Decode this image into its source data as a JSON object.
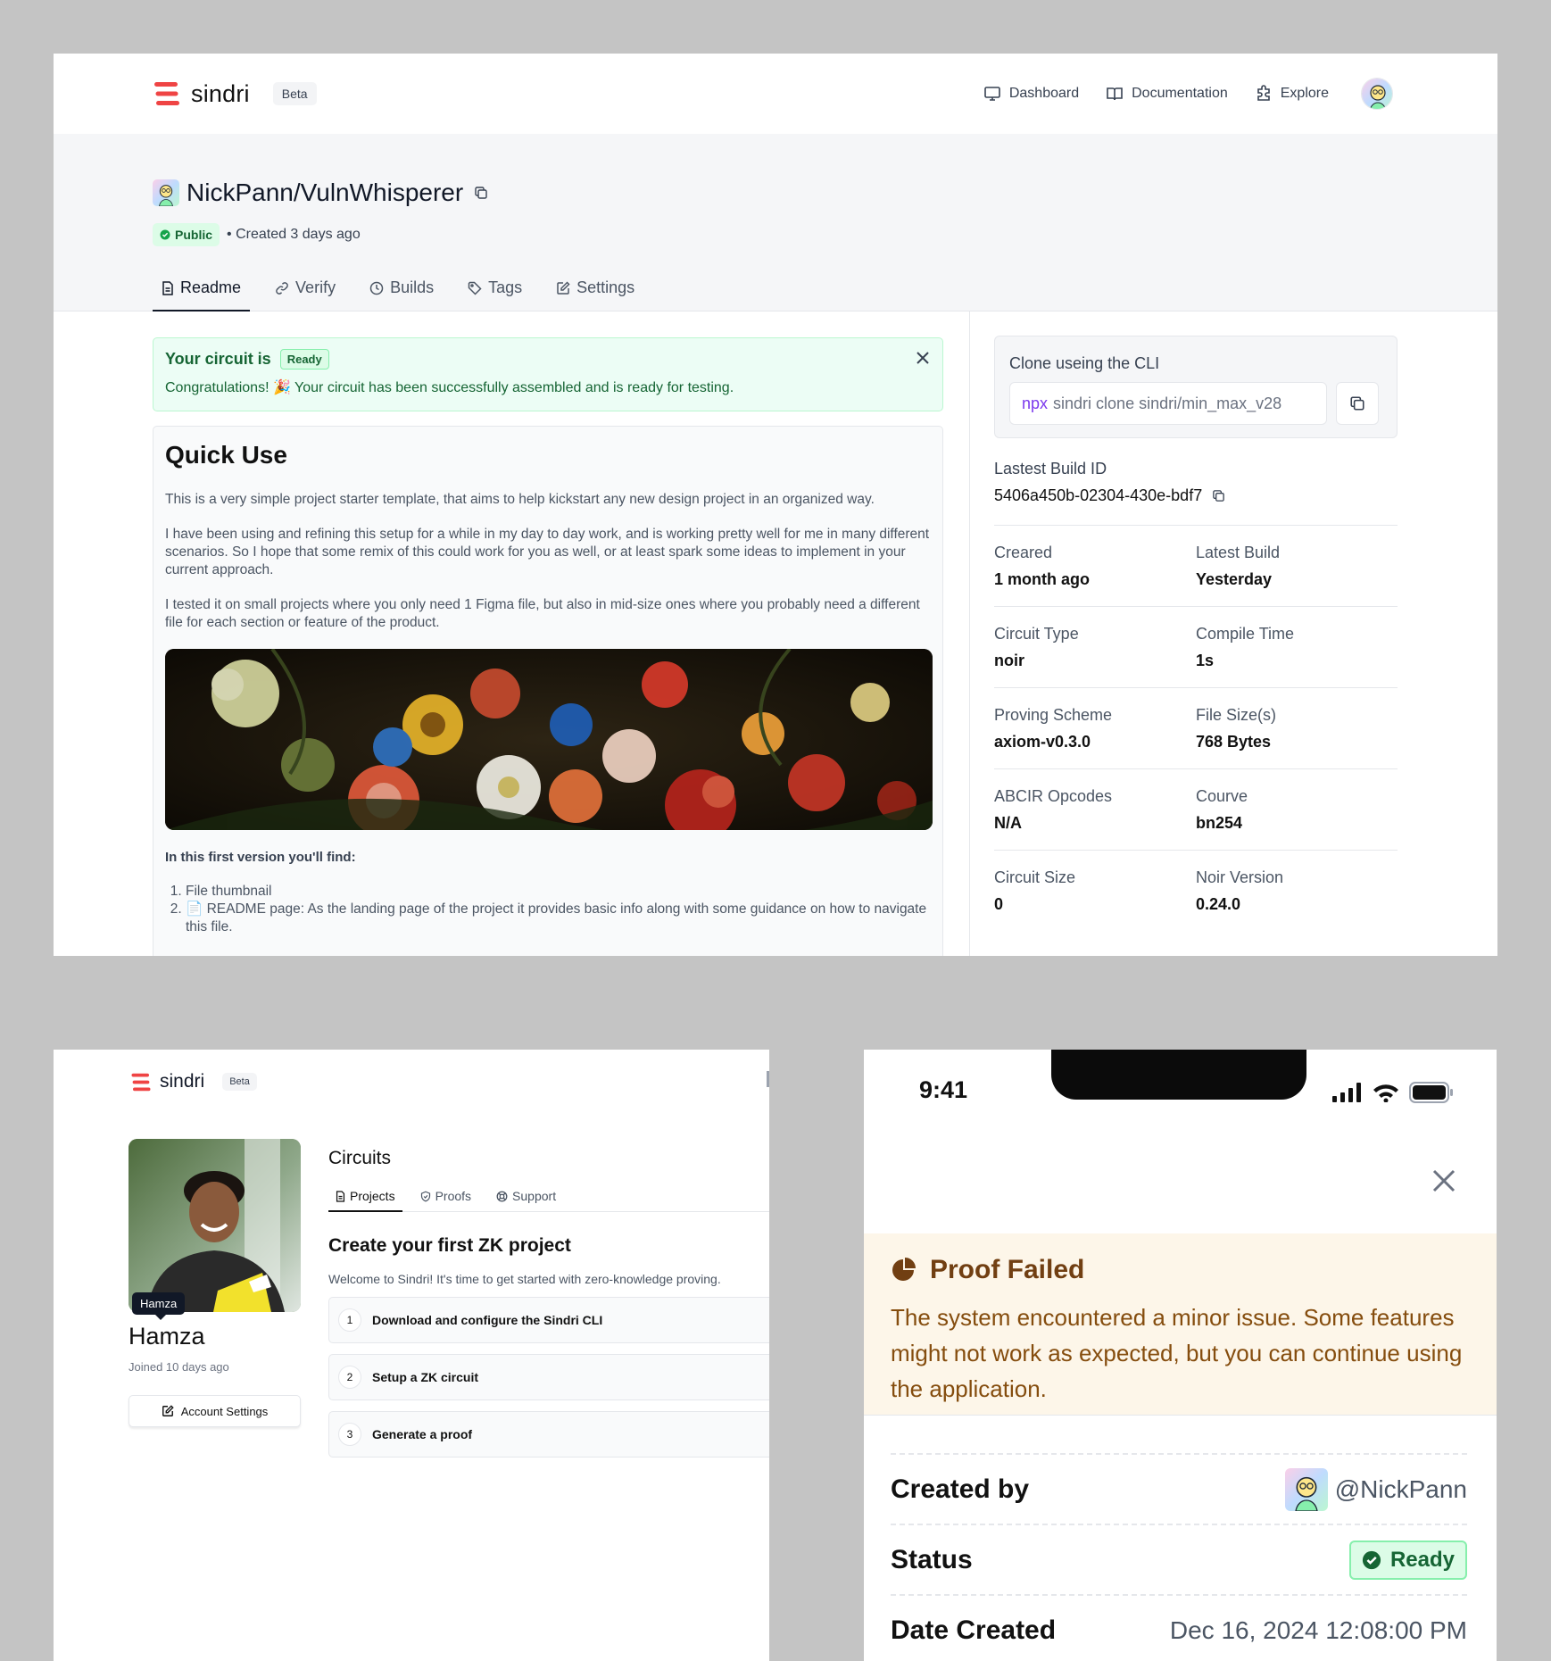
{
  "colors": {
    "brand": "#ef4444",
    "success": "#166534",
    "warning": "#713f12",
    "accent_purple": "#7c3aed"
  },
  "top": {
    "brand": {
      "name": "sindri",
      "beta": "Beta"
    },
    "nav": [
      {
        "label": "Dashboard",
        "icon": "monitor-icon"
      },
      {
        "label": "Documentation",
        "icon": "book-icon"
      },
      {
        "label": "Explore",
        "icon": "puzzle-icon"
      }
    ],
    "repo": {
      "title": "NickPann/VulnWhisperer",
      "visibility": "Public",
      "created": "• Created 3 days ago"
    },
    "tabs": [
      {
        "label": "Readme",
        "icon": "document-icon",
        "active": true
      },
      {
        "label": "Verify",
        "icon": "link-icon"
      },
      {
        "label": "Builds",
        "icon": "clock-icon"
      },
      {
        "label": "Tags",
        "icon": "tag-icon"
      },
      {
        "label": "Settings",
        "icon": "edit-icon"
      }
    ],
    "alert": {
      "title": "Your circuit is",
      "badge": "Ready",
      "message": "Congratulations! 🎉  Your circuit has been successfully assembled and is ready for testing."
    },
    "readme": {
      "heading": "Quick Use",
      "paragraphs": [
        "This is a very simple project starter template, that aims to help kickstart any new design project in an organized way.",
        "I have been using and refining this setup for a while in my day to day work, and is working pretty well for me in many different scenarios. So I hope that some remix of this could work for you as well, or at least spark some ideas to implement in your current approach.",
        "I tested it on small projects where you only need 1 Figma file, but also in mid-size ones where you probably need a different file for each section or feature of the product."
      ],
      "subheading": "In this first version you'll find:",
      "list": [
        "File thumbnail",
        "📄 README page: As the landing page of the project it provides basic info along with some guidance on how to navigate this file."
      ]
    },
    "clone": {
      "label": "Clone useing the CLI",
      "prefix": "npx",
      "command": "sindri clone sindri/min_max_v28"
    },
    "build": {
      "label": "Lastest Build ID",
      "value": "5406a450b-02304-430e-bdf7"
    },
    "stats": [
      [
        {
          "k": "Creared",
          "v": "1  month ago"
        },
        {
          "k": "Latest Build",
          "v": "Yesterday"
        }
      ],
      [
        {
          "k": "Circuit Type",
          "v": "noir"
        },
        {
          "k": "Compile Time",
          "v": "1s"
        }
      ],
      [
        {
          "k": "Proving Scheme",
          "v": "axiom-v0.3.0"
        },
        {
          "k": "File Size(s)",
          "v": "768 Bytes"
        }
      ],
      [
        {
          "k": "ABCIR Opcodes",
          "v": "N/A"
        },
        {
          "k": "Courve",
          "v": "bn254"
        }
      ],
      [
        {
          "k": "Circuit Size",
          "v": "0"
        },
        {
          "k": "Noir Version",
          "v": "0.24.0"
        }
      ]
    ]
  },
  "profile": {
    "brand": {
      "name": "sindri",
      "beta": "Beta"
    },
    "tooltip": "Hamza",
    "name": "Hamza",
    "joined": "Joined 10 days ago",
    "account_button": "Account Settings",
    "circuits_title": "Circuits",
    "tabs": [
      {
        "label": "Projects",
        "icon": "document-icon",
        "active": true
      },
      {
        "label": "Proofs",
        "icon": "shield-icon"
      },
      {
        "label": "Support",
        "icon": "lifebuoy-icon"
      }
    ],
    "heading": "Create your first ZK project",
    "welcome": "Welcome to Sindri! It's time to get started with zero-knowledge proving.",
    "steps": [
      {
        "num": "1",
        "label": "Download and configure the Sindri CLI"
      },
      {
        "num": "2",
        "label": "Setup a ZK circuit"
      },
      {
        "num": "3",
        "label": "Generate a proof"
      }
    ]
  },
  "mobile": {
    "time": "9:41",
    "alert": {
      "title": "Proof Failed",
      "message": "The system encountered a minor issue. Some features might not work as expected, but you can continue using the application."
    },
    "details": [
      {
        "k": "Created by",
        "v": "@NickPann"
      },
      {
        "k": "Status",
        "v": "Ready"
      },
      {
        "k": "Date Created",
        "v": "Dec 16, 2024 12:08:00 PM"
      }
    ]
  }
}
